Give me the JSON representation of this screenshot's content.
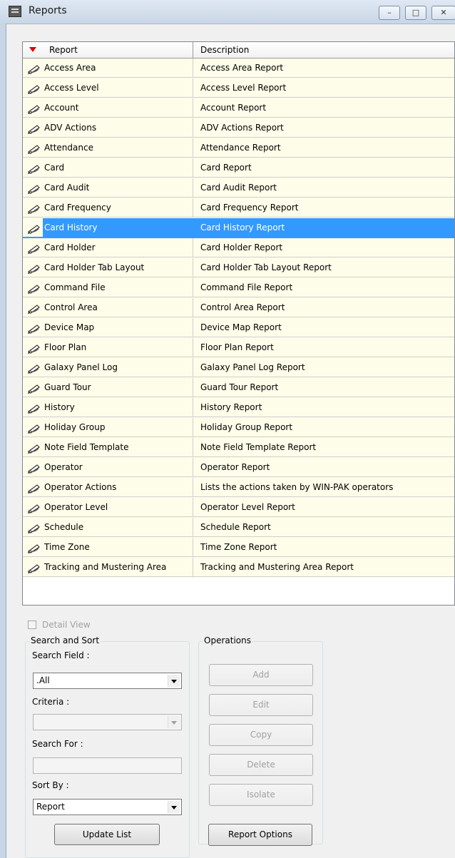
{
  "window": {
    "title": "Reports",
    "minimize_glyph": "–",
    "maximize_glyph": "□",
    "close_glyph": "✕"
  },
  "grid": {
    "columns": [
      "Report",
      "Description"
    ],
    "selected_index": 8,
    "rows": [
      {
        "report": "Access Area",
        "description": "Access Area Report"
      },
      {
        "report": "Access Level",
        "description": "Access Level Report"
      },
      {
        "report": "Account",
        "description": "Account Report"
      },
      {
        "report": "ADV Actions",
        "description": "ADV Actions Report"
      },
      {
        "report": "Attendance",
        "description": "Attendance Report"
      },
      {
        "report": "Card",
        "description": "Card Report"
      },
      {
        "report": "Card Audit",
        "description": "Card Audit Report"
      },
      {
        "report": "Card Frequency",
        "description": "Card Frequency Report"
      },
      {
        "report": "Card History",
        "description": "Card History Report"
      },
      {
        "report": "Card Holder",
        "description": "Card Holder Report"
      },
      {
        "report": "Card Holder Tab Layout",
        "description": "Card Holder Tab Layout Report"
      },
      {
        "report": "Command File",
        "description": "Command File Report"
      },
      {
        "report": "Control Area",
        "description": "Control Area Report"
      },
      {
        "report": "Device Map",
        "description": "Device Map Report"
      },
      {
        "report": "Floor Plan",
        "description": "Floor Plan Report"
      },
      {
        "report": "Galaxy Panel Log",
        "description": "Galaxy Panel Log Report"
      },
      {
        "report": "Guard Tour",
        "description": "Guard Tour Report"
      },
      {
        "report": "History",
        "description": "History Report"
      },
      {
        "report": "Holiday Group",
        "description": "Holiday Group Report"
      },
      {
        "report": "Note Field Template",
        "description": "Note Field Template Report"
      },
      {
        "report": "Operator",
        "description": "Operator Report"
      },
      {
        "report": "Operator Actions",
        "description": "Lists the actions taken by WIN-PAK operators"
      },
      {
        "report": "Operator Level",
        "description": "Operator Level Report"
      },
      {
        "report": "Schedule",
        "description": "Schedule Report"
      },
      {
        "report": "Time Zone",
        "description": "Time Zone Report"
      },
      {
        "report": "Tracking and Mustering Area",
        "description": "Tracking and Mustering Area Report"
      }
    ],
    "colors": {
      "row_bg": "#fdfde9",
      "selected_bg": "#3399ff",
      "sort_arrow": "#e00000"
    }
  },
  "detail_view": {
    "label": "Detail View",
    "checked": false,
    "enabled": false
  },
  "search_sort": {
    "title": "Search and Sort",
    "search_field_label": "Search Field :",
    "search_field_value": ".All",
    "criteria_label": "Criteria :",
    "criteria_value": "",
    "search_for_label": "Search For :",
    "search_for_value": "",
    "sort_by_label": "Sort By :",
    "sort_by_value": "Report",
    "update_button": "Update List"
  },
  "operations": {
    "title": "Operations",
    "add": "Add",
    "edit": "Edit",
    "copy": "Copy",
    "delete": "Delete",
    "isolate": "Isolate"
  },
  "report_options_button": "Report Options"
}
